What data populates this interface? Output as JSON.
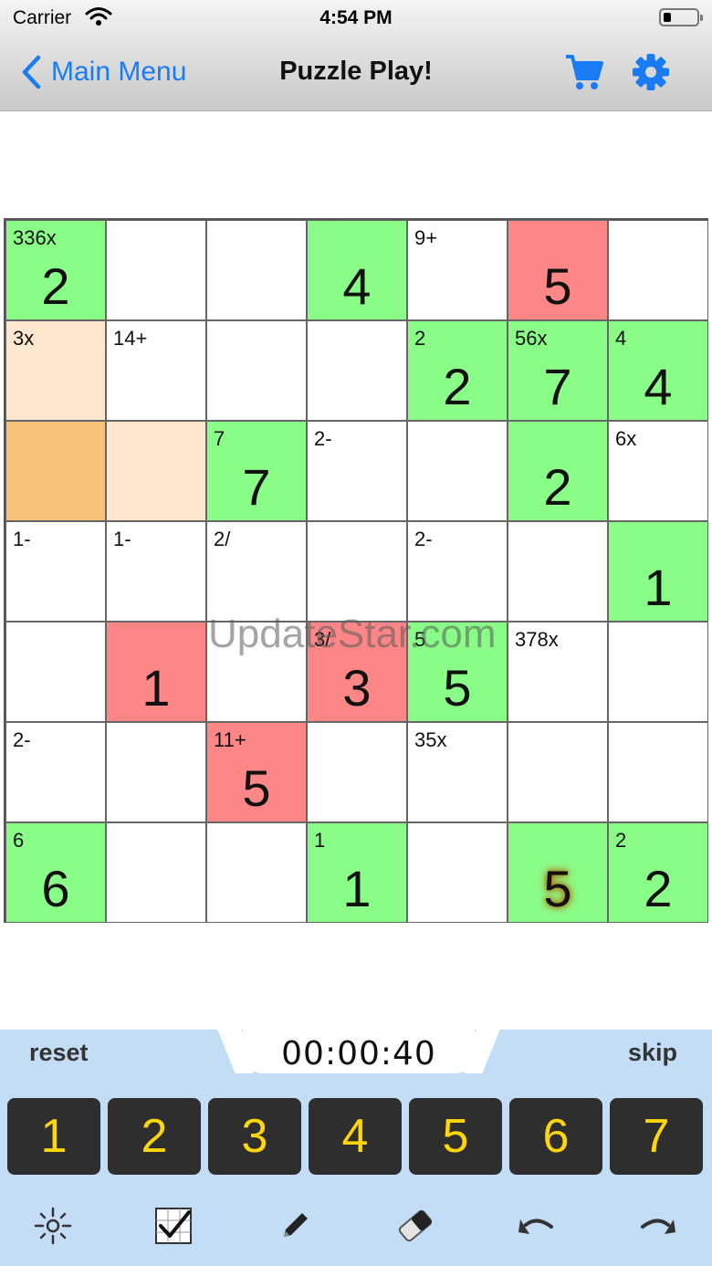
{
  "status_bar": {
    "carrier": "Carrier",
    "time": "4:54 PM"
  },
  "nav": {
    "back_label": "Main Menu",
    "title": "Puzzle Play!"
  },
  "colors": {
    "accent": "#1a7cf5",
    "correct": "#8afd88",
    "wrong": "#fd8787",
    "highlight": "#fde8cf",
    "selected": "#f7c17a",
    "key_digit": "#ffd60a",
    "panel": "#c3ddf7"
  },
  "board": {
    "rows": [
      [
        {
          "clue": "336x",
          "value": "2",
          "state": "green"
        },
        {
          "clue": "",
          "value": "",
          "state": ""
        },
        {
          "clue": "",
          "value": "",
          "state": ""
        },
        {
          "clue": "",
          "value": "4",
          "state": "green"
        },
        {
          "clue": "9+",
          "value": "",
          "state": ""
        },
        {
          "clue": "",
          "value": "5",
          "state": "red"
        },
        {
          "clue": "",
          "value": "",
          "state": ""
        }
      ],
      [
        {
          "clue": "3x",
          "value": "",
          "state": "peach"
        },
        {
          "clue": "14+",
          "value": "",
          "state": ""
        },
        {
          "clue": "",
          "value": "",
          "state": ""
        },
        {
          "clue": "",
          "value": "",
          "state": ""
        },
        {
          "clue": "2",
          "value": "2",
          "state": "green"
        },
        {
          "clue": "56x",
          "value": "7",
          "state": "green"
        },
        {
          "clue": "4",
          "value": "4",
          "state": "green"
        }
      ],
      [
        {
          "clue": "",
          "value": "",
          "state": "orange"
        },
        {
          "clue": "",
          "value": "",
          "state": "peach"
        },
        {
          "clue": "7",
          "value": "7",
          "state": "green"
        },
        {
          "clue": "2-",
          "value": "",
          "state": ""
        },
        {
          "clue": "",
          "value": "",
          "state": ""
        },
        {
          "clue": "",
          "value": "2",
          "state": "green"
        },
        {
          "clue": "6x",
          "value": "",
          "state": ""
        }
      ],
      [
        {
          "clue": "1-",
          "value": "",
          "state": ""
        },
        {
          "clue": "1-",
          "value": "",
          "state": ""
        },
        {
          "clue": "2/",
          "value": "",
          "state": ""
        },
        {
          "clue": "",
          "value": "",
          "state": ""
        },
        {
          "clue": "2-",
          "value": "",
          "state": ""
        },
        {
          "clue": "",
          "value": "",
          "state": ""
        },
        {
          "clue": "",
          "value": "1",
          "state": "green"
        }
      ],
      [
        {
          "clue": "",
          "value": "",
          "state": ""
        },
        {
          "clue": "",
          "value": "1",
          "state": "red"
        },
        {
          "clue": "",
          "value": "",
          "state": ""
        },
        {
          "clue": "3/",
          "value": "3",
          "state": "red"
        },
        {
          "clue": "5",
          "value": "5",
          "state": "green"
        },
        {
          "clue": "378x",
          "value": "",
          "state": ""
        },
        {
          "clue": "",
          "value": "",
          "state": ""
        }
      ],
      [
        {
          "clue": "2-",
          "value": "",
          "state": ""
        },
        {
          "clue": "",
          "value": "",
          "state": ""
        },
        {
          "clue": "11+",
          "value": "5",
          "state": "red"
        },
        {
          "clue": "",
          "value": "",
          "state": ""
        },
        {
          "clue": "35x",
          "value": "",
          "state": ""
        },
        {
          "clue": "",
          "value": "",
          "state": ""
        },
        {
          "clue": "",
          "value": "",
          "state": ""
        }
      ],
      [
        {
          "clue": "6",
          "value": "6",
          "state": "green"
        },
        {
          "clue": "",
          "value": "",
          "state": ""
        },
        {
          "clue": "",
          "value": "",
          "state": ""
        },
        {
          "clue": "1",
          "value": "1",
          "state": "green"
        },
        {
          "clue": "",
          "value": "",
          "state": ""
        },
        {
          "clue": "",
          "value": "5",
          "state": "green",
          "glow": true
        },
        {
          "clue": "2",
          "value": "2",
          "state": "green"
        }
      ]
    ]
  },
  "watermark": "UpdateStar.com",
  "controls": {
    "reset_label": "reset",
    "skip_label": "skip",
    "timer": "00:00:40"
  },
  "keypad": [
    "1",
    "2",
    "3",
    "4",
    "5",
    "6",
    "7"
  ],
  "tools": [
    "hint-icon",
    "check-icon",
    "pencil-icon",
    "eraser-icon",
    "undo-icon",
    "redo-icon"
  ]
}
